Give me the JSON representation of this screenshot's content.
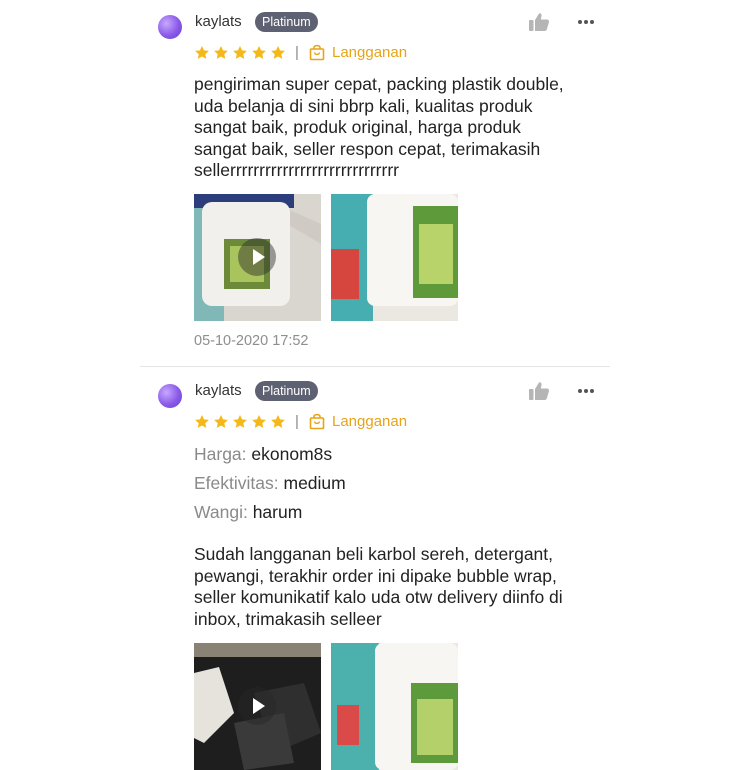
{
  "reviews": [
    {
      "username": "kaylats",
      "badge": "Platinum",
      "rating": 5,
      "separator": "|",
      "subscription_label": "Langganan",
      "text_lines": [
        "pengiriman super cepat, packing plastik double,",
        "uda belanja di sini bbrp kali, kualitas produk",
        "sangat baik, produk original, harga produk",
        "sangat baik, seller respon cepat, terimakasih",
        "sellerrrrrrrrrrrrrrrrrrrrrrrrrrrrr"
      ],
      "media": [
        {
          "kind": "video",
          "icon": "play-icon"
        },
        {
          "kind": "image"
        }
      ],
      "timestamp": "05-10-2020 17:52"
    },
    {
      "username": "kaylats",
      "badge": "Platinum",
      "rating": 5,
      "separator": "|",
      "subscription_label": "Langganan",
      "attributes": [
        {
          "key": "Harga:",
          "value": "ekonom8s"
        },
        {
          "key": "Efektivitas:",
          "value": "medium"
        },
        {
          "key": "Wangi:",
          "value": "harum"
        }
      ],
      "text_lines": [
        "Sudah langganan beli karbol sereh, detergant,",
        "pewangi, terakhir order ini dipake bubble wrap,",
        "seller komunikatif kalo uda otw delivery diinfo di",
        "inbox, trimakasih selleer"
      ],
      "media": [
        {
          "kind": "video",
          "icon": "play-icon"
        },
        {
          "kind": "image"
        }
      ]
    }
  ],
  "icons": {
    "like": "thumbs-up-icon",
    "more": "more-horizontal-icon",
    "star": "star-icon",
    "subscription": "shopping-bag-icon"
  },
  "colors": {
    "star": "#f5b819",
    "subscription": "#e8a417",
    "badge_bg": "#5e6172",
    "meta_text": "#8e8e8e"
  }
}
